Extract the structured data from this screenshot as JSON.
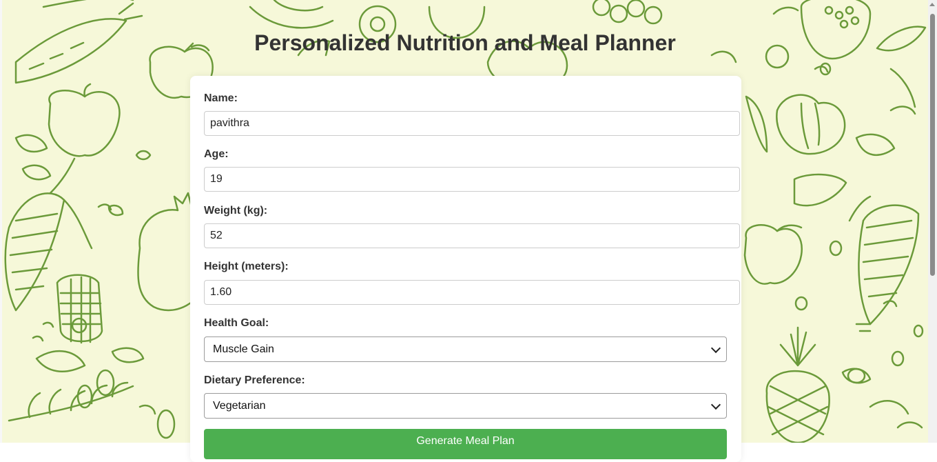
{
  "page": {
    "title": "Personalized Nutrition and Meal Planner"
  },
  "form": {
    "name": {
      "label": "Name:",
      "value": "pavithra"
    },
    "age": {
      "label": "Age:",
      "value": "19"
    },
    "weight": {
      "label": "Weight (kg):",
      "value": "52"
    },
    "height": {
      "label": "Height (meters):",
      "value": "1.60"
    },
    "health_goal": {
      "label": "Health Goal:",
      "selected": "Muscle Gain"
    },
    "dietary_preference": {
      "label": "Dietary Preference:",
      "selected": "Vegetarian"
    },
    "submit_label": "Generate Meal Plan"
  },
  "colors": {
    "background": "#f6f8d9",
    "doodle": "#6b9a3a",
    "button": "#4caf50",
    "title": "#333333"
  }
}
